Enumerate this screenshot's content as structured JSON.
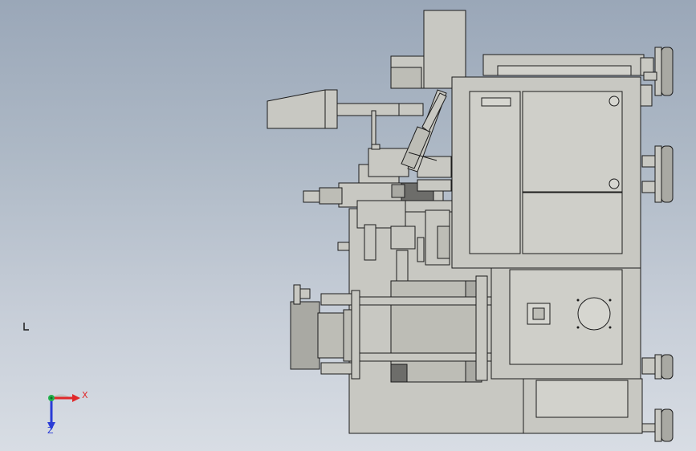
{
  "view": {
    "background_top": "#9aa7b8",
    "background_bottom": "#d8dde4",
    "model_fill": "#c8c8c2",
    "model_edge": "#1c1c1c",
    "panel_fill": "#cfcfc9",
    "dark_part": "#6d6d6a"
  },
  "triad": {
    "x_label": "X",
    "y_label": "Y",
    "z_label": "Z",
    "x_color": "#e0282a",
    "y_color": "#22b14c",
    "z_color": "#2a3cd6"
  }
}
